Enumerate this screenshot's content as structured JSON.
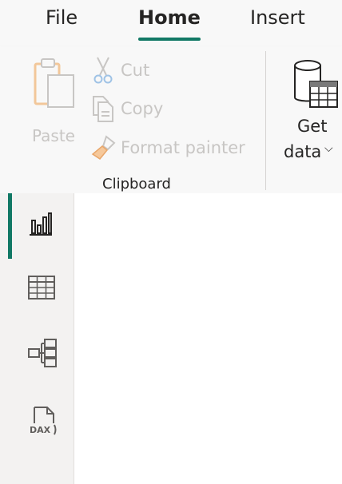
{
  "tabs": {
    "file": "File",
    "home": "Home",
    "insert": "Insert"
  },
  "clipboard": {
    "paste": "Paste",
    "cut": "Cut",
    "copy": "Copy",
    "format_painter": "Format painter",
    "group_label": "Clipboard"
  },
  "get_data": {
    "line1": "Get",
    "line2": "data"
  },
  "left_nav": [
    {
      "name": "report-view",
      "icon": "bar-chart-icon",
      "active": true
    },
    {
      "name": "table-view",
      "icon": "table-grid-icon",
      "active": false
    },
    {
      "name": "model-view",
      "icon": "model-icon",
      "active": false
    },
    {
      "name": "dax-query-view",
      "icon": "dax-icon",
      "active": false,
      "label": "DAX"
    }
  ],
  "colors": {
    "accent": "#117865",
    "ribbon_bg": "#f8f8f8",
    "nav_bg": "#f3f2f1",
    "disabled_text": "#c8c6c4",
    "text": "#252423"
  }
}
